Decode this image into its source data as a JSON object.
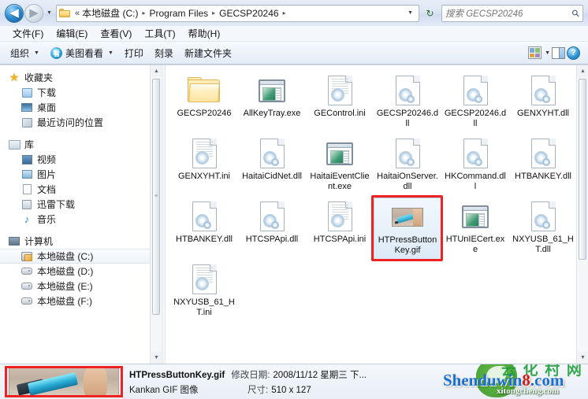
{
  "addressbar": {
    "back_glyph": "◀",
    "forward_glyph": "▶",
    "history_caret": "▼",
    "folder_icon": "folder-icon",
    "ellipsis": "«",
    "crumbs": [
      "本地磁盘 (C:)",
      "Program Files",
      "GECSP20246"
    ],
    "chevron": "▸",
    "dropdown_caret": "▼",
    "refresh_glyph": "↻",
    "search_placeholder": "搜索 GECSP20246",
    "search_glyph": "⚲"
  },
  "menubar": {
    "items": [
      "文件(F)",
      "编辑(E)",
      "查看(V)",
      "工具(T)",
      "帮助(H)"
    ]
  },
  "toolbar": {
    "organize_label": "组织",
    "organize_caret": "▼",
    "meitu_label": "美图看看",
    "meitu_badge": "看",
    "meitu_caret": "▼",
    "print_label": "打印",
    "burn_label": "刻录",
    "newfolder_label": "新建文件夹",
    "view_icon": "view-layout-icon",
    "view_caret": "▼",
    "preview_pane_icon": "preview-pane-icon",
    "help_icon": "help-icon",
    "help_glyph": "?"
  },
  "navpane": {
    "groups": [
      {
        "label": "收藏夹",
        "icon": "star-icon",
        "items": [
          {
            "label": "下载",
            "icon": "download-icon"
          },
          {
            "label": "桌面",
            "icon": "desktop-icon"
          },
          {
            "label": "最近访问的位置",
            "icon": "recent-places-icon"
          }
        ]
      },
      {
        "label": "库",
        "icon": "library-icon",
        "items": [
          {
            "label": "视频",
            "icon": "video-icon"
          },
          {
            "label": "图片",
            "icon": "pictures-icon"
          },
          {
            "label": "文档",
            "icon": "documents-icon"
          },
          {
            "label": "迅雷下载",
            "icon": "thunder-download-icon"
          },
          {
            "label": "音乐",
            "icon": "music-icon"
          }
        ]
      },
      {
        "label": "计算机",
        "icon": "computer-icon",
        "items": [
          {
            "label": "本地磁盘 (C:)",
            "icon": "system-drive-icon",
            "selected": true
          },
          {
            "label": "本地磁盘 (D:)",
            "icon": "drive-icon",
            "selected": false
          },
          {
            "label": "本地磁盘 (E:)",
            "icon": "drive-icon",
            "selected": false
          },
          {
            "label": "本地磁盘 (F:)",
            "icon": "drive-icon",
            "selected": false
          }
        ]
      }
    ],
    "scroll_up_glyph": "▲",
    "scroll_down_glyph": "▼",
    "grip_glyph": "≡"
  },
  "files": [
    {
      "name": "GECSP20246",
      "type": "folder",
      "selected": false,
      "highlight": false
    },
    {
      "name": "AllKeyTray.exe",
      "type": "exe",
      "selected": false,
      "highlight": false
    },
    {
      "name": "GEControl.ini",
      "type": "ini",
      "selected": false,
      "highlight": false
    },
    {
      "name": "GECSP20246.dll",
      "type": "dll",
      "selected": false,
      "highlight": false
    },
    {
      "name": "GECSP20246.dll",
      "type": "dll",
      "selected": false,
      "highlight": false
    },
    {
      "name": "GENXYHT.dll",
      "type": "dll",
      "selected": false,
      "highlight": false
    },
    {
      "name": "GENXYHT.ini",
      "type": "ini",
      "selected": false,
      "highlight": false
    },
    {
      "name": "HaitaiCidNet.dll",
      "type": "dll",
      "selected": false,
      "highlight": false
    },
    {
      "name": "HaitaiEventClient.exe",
      "type": "exe",
      "selected": false,
      "highlight": false
    },
    {
      "name": "HaitaiOnServer.dll",
      "type": "dll",
      "selected": false,
      "highlight": false
    },
    {
      "name": "HKCommand.dll",
      "type": "dll",
      "selected": false,
      "highlight": false
    },
    {
      "name": "HTBANKEY.dll",
      "type": "dll",
      "selected": false,
      "highlight": false
    },
    {
      "name": "HTBANKEY.dll",
      "type": "dll",
      "selected": false,
      "highlight": false
    },
    {
      "name": "HTCSPApi.dll",
      "type": "dll",
      "selected": false,
      "highlight": false
    },
    {
      "name": "HTCSPApi.ini",
      "type": "ini",
      "selected": false,
      "highlight": false
    },
    {
      "name": "HTPressButtonKey.gif",
      "type": "gif",
      "selected": true,
      "highlight": true
    },
    {
      "name": "HTUnIECert.exe",
      "type": "exe",
      "selected": false,
      "highlight": false
    },
    {
      "name": "NXYUSB_61_HT.dll",
      "type": "dll",
      "selected": false,
      "highlight": false
    },
    {
      "name": "NXYUSB_61_HT.ini",
      "type": "ini",
      "selected": false,
      "highlight": false
    }
  ],
  "details": {
    "thumbnail": "gif-preview-thumbnail",
    "filename": "HTPressButtonKey.gif",
    "modified_key": "修改日期:",
    "modified_value": "2008/11/12 星期三 下...",
    "type_value": "Kankan GIF 图像",
    "size_key": "尺寸:",
    "size_value": "510 x 127"
  },
  "watermark": {
    "main_blue": "Shenduwin",
    "main_red": "8",
    "main_tld": ".com",
    "sub": "xitongcheng.com",
    "cn": "云 化 村 网"
  }
}
